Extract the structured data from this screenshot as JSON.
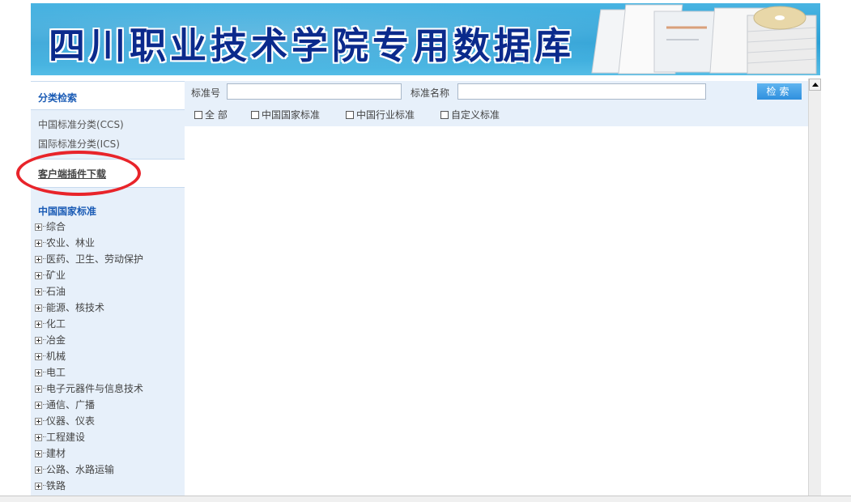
{
  "banner": {
    "title": "四川职业技术学院专用数据库"
  },
  "sidebar": {
    "classify_title": "分类检索",
    "links": [
      {
        "label": "中国标准分类(CCS)"
      },
      {
        "label": "国际标准分类(ICS)"
      }
    ],
    "plugin_label": "客户端插件下载",
    "annotation_color": "#e8242a",
    "tree_title": "中国国家标准",
    "tree_items": [
      "综合",
      "农业、林业",
      "医药、卫生、劳动保护",
      "矿业",
      "石油",
      "能源、核技术",
      "化工",
      "冶金",
      "机械",
      "电工",
      "电子元器件与信息技术",
      "通信、广播",
      "仪器、仪表",
      "工程建设",
      "建材",
      "公路、水路运输",
      "铁路"
    ]
  },
  "search": {
    "standard_no_label": "标准号",
    "standard_no_value": "",
    "standard_name_label": "标准名称",
    "standard_name_value": "",
    "button_label": "检索",
    "button_color": "#2f8fde",
    "checkboxes": [
      {
        "label": "全 部",
        "checked": false
      },
      {
        "label": "中国国家标准",
        "checked": false
      },
      {
        "label": "中国行业标准",
        "checked": false
      },
      {
        "label": "自定义标准",
        "checked": false
      }
    ]
  }
}
